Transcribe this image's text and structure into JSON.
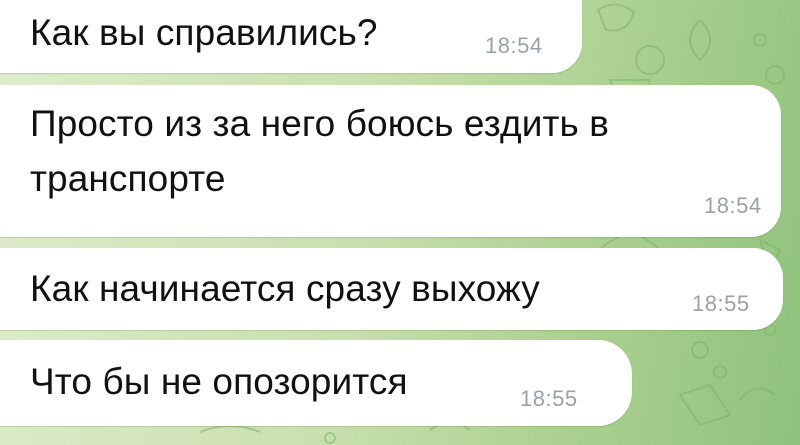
{
  "theme": {
    "background_accent": "#a9cf8f",
    "bubble_color": "#ffffff",
    "text_color": "#111111",
    "time_color": "#9aa1a6"
  },
  "messages": [
    {
      "text": "Как вы справились?",
      "time": "18:54"
    },
    {
      "text": "Просто из за него боюсь ездить в транспорте",
      "time": "18:54"
    },
    {
      "text": "Как начинается сразу выхожу",
      "time": "18:55"
    },
    {
      "text": "Что бы не опозорится",
      "time": "18:55"
    }
  ]
}
